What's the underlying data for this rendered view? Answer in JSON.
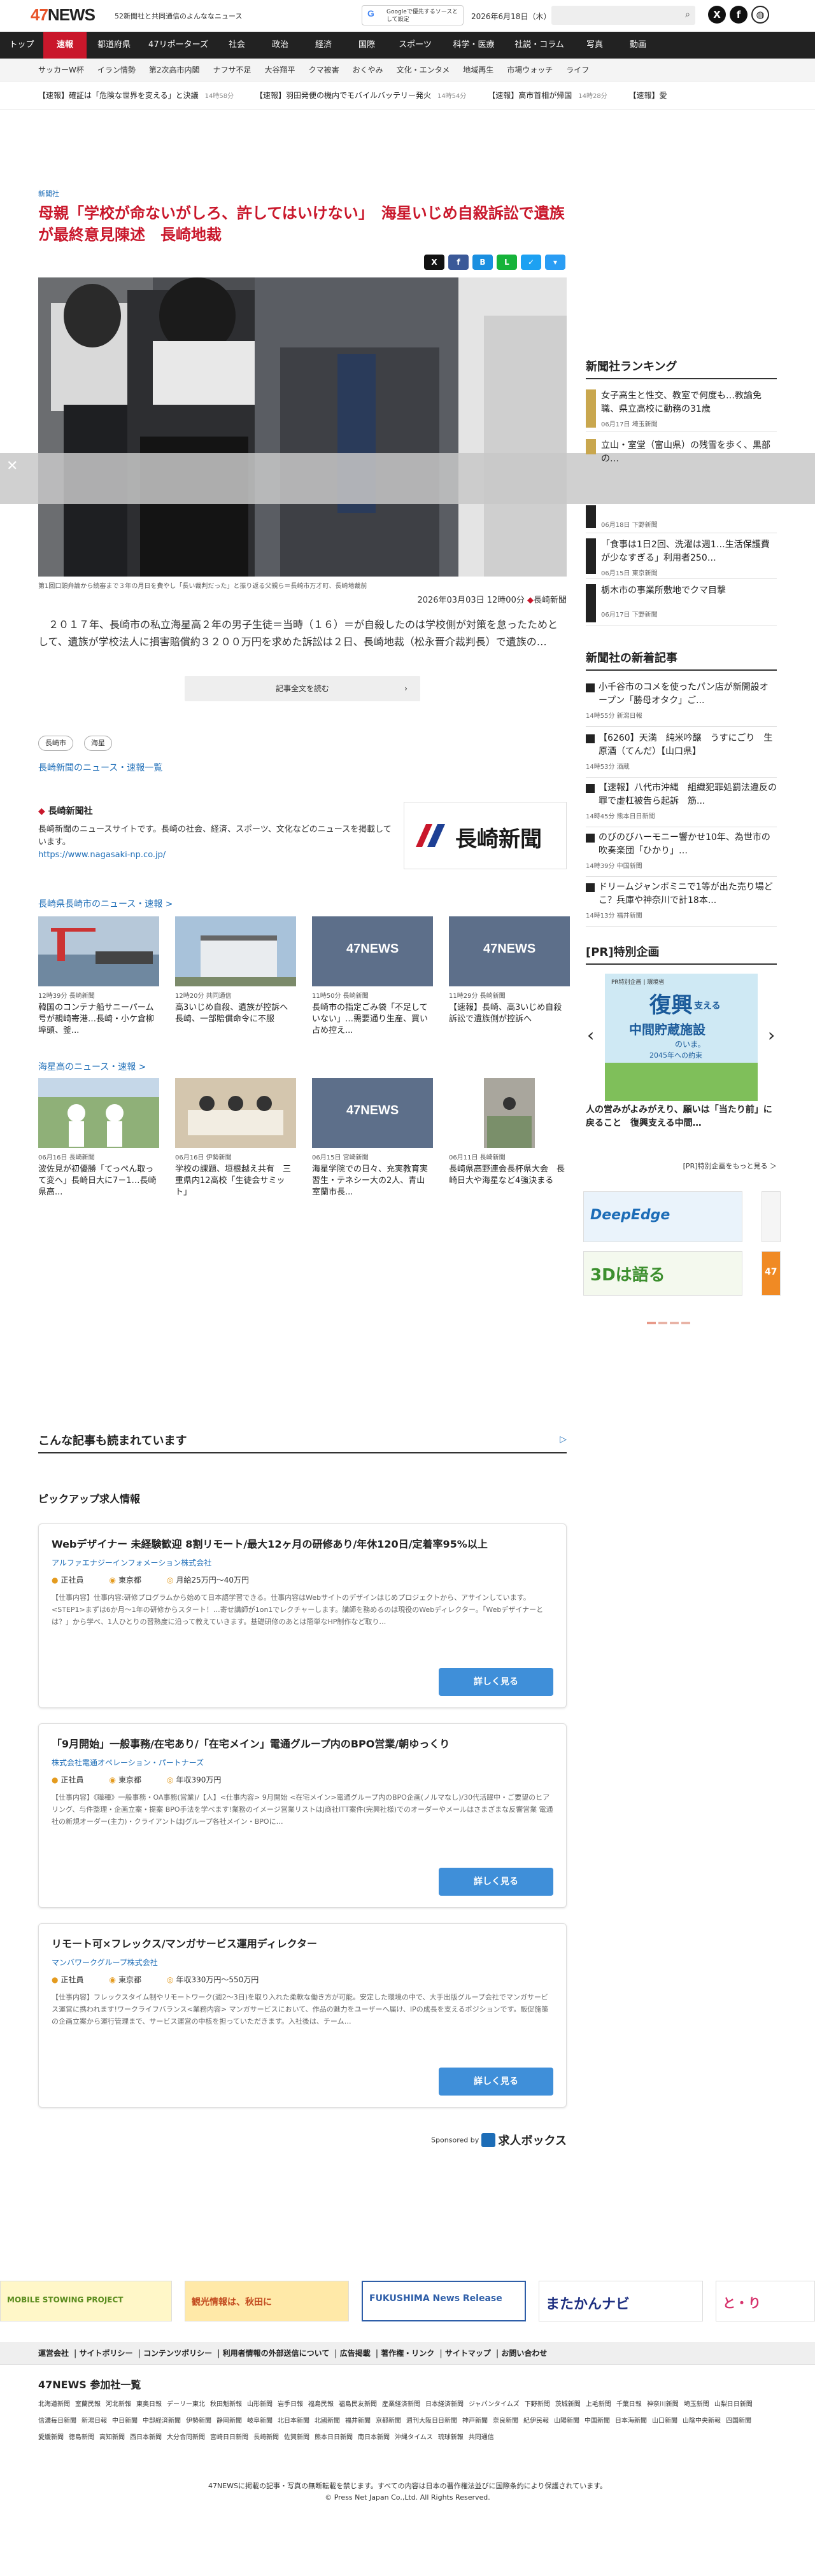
{
  "header": {
    "logo_num": "47",
    "logo_text": "NEWS",
    "tagline": "52新聞社と共同通信のよんななニュース",
    "google_btn": "Googleで優先するソースとして設定",
    "date": "2026年6月18日（木）"
  },
  "nav": [
    "トップ",
    "速報",
    "都道府県",
    "47リポーターズ",
    "社会",
    "政治",
    "経済",
    "国際",
    "スポーツ",
    "科学・医療",
    "社説・コラム",
    "写真",
    "動画"
  ],
  "subnav": [
    "サッカーW杯",
    "イラン情勢",
    "第2次高市内閣",
    "ナフサ不足",
    "大谷翔平",
    "クマ被害",
    "おくやみ",
    "文化・エンタメ",
    "地域再生",
    "市場ウォッチ",
    "ライフ"
  ],
  "ticker": [
    {
      "text": "【速報】確証は「危険な世界を変える」と決議",
      "time": "14時58分"
    },
    {
      "text": "【速報】羽田発便の機内でモバイルバッテリー発火",
      "time": "14時54分"
    },
    {
      "text": "【速報】高市首相が帰国",
      "time": "14時28分"
    },
    {
      "text": "【速報】愛"
    }
  ],
  "article": {
    "source": "新聞社",
    "headline": "母親「学校が命ないがしろ、許してはいけない」　海星いじめ自殺訴訟で遺族が最終意見陳述　長崎地裁",
    "caption": "第1回口頭弁論から続審まで３年の月日を費やし「長い裁判だった」と振り返る父親ら＝長崎市万才町、長崎地裁前",
    "datetime": "2026年03月03日 12時00分",
    "publisher": "長崎新聞",
    "lead": "　２０１７年、長崎市の私立海星高２年の男子生徒＝当時（１６）＝が自殺したのは学校側が対策を怠ったためとして、遺族が学校法人に損害賠償約３２００万円を求めた訴訟は２日、長崎地裁（松永晋介裁判長）で遺族の…",
    "readmore": "記事全文を読む",
    "tags": [
      "長崎市",
      "海星"
    ],
    "more_link": "長崎新聞のニュース・速報一覧"
  },
  "publisher_box": {
    "name": "長崎新聞社",
    "desc": "長崎新聞のニュースサイトです。長崎の社会、経済、スポーツ、文化などのニュースを掲載しています。",
    "url": "https://www.nagasaki-np.co.jp/",
    "logo_text": "長崎新聞"
  },
  "sec1": {
    "title": "長崎県長崎市のニュース・速報 >",
    "cards": [
      {
        "meta": "12時39分 長崎新聞",
        "title": "韓国のコンテナ船サニーパーム号が親崎寄港…長崎・小ケ倉柳埠頭、釜..."
      },
      {
        "meta": "12時20分 共同通信",
        "title": "高3いじめ自殺、遺族が控訴へ　長崎、一部賠償命令に不服"
      },
      {
        "meta": "11時50分 長崎新聞",
        "title": "長崎市の指定ごみ袋「不足していない」…需要通り生産、買い占め控え..."
      },
      {
        "meta": "11時29分 長崎新聞",
        "title": "【速報】長崎、高3いじめ自殺訴訟で遺族側が控訴へ"
      }
    ]
  },
  "sec2": {
    "title": "海星高のニュース・速報 >",
    "cards": [
      {
        "meta": "06月16日 長崎新聞",
        "title": "波佐見が初優勝「てっぺん取って変へ」長崎日大に7－1…長崎県高..."
      },
      {
        "meta": "06月16日 伊勢新聞",
        "title": "学校の課題、垣根越え共有　三重県内12高校「生徒会サミット」"
      },
      {
        "meta": "06月15日 宮崎新聞",
        "title": "海星学院での日々、充実教育実習生・テネシー大の2人、青山室蘭市長..."
      },
      {
        "meta": "06月11日 長崎新聞",
        "title": "長崎県高野連会長杯県大会　長崎日大や海星など4強決まる"
      }
    ]
  },
  "sidebar": {
    "ranking_title": "新聞社ランキング",
    "ranking": [
      {
        "title": "女子高生と性交、教室で何度も…教諭免職、県立高校に勤務の31歳",
        "meta": "06月17日 埼玉新聞"
      },
      {
        "title": "立山・室堂（富山県）の残雪を歩く、黒部の…",
        "meta": ""
      },
      {
        "title": "",
        "meta": "06月18日 下野新聞"
      },
      {
        "title": "「食事は1日2回、洗濯は週1…生活保護費が少なすぎる」利用者250…",
        "meta": "06月15日 東京新聞"
      },
      {
        "title": "栃木市の事業所敷地でクマ目撃",
        "meta": "06月17日 下野新聞"
      }
    ],
    "latest_title": "新聞社の新着記事",
    "latest": [
      {
        "title": "小千谷市のコメを使ったパン店が新開設オープン「勝母オタク」ご...",
        "meta": "14時55分 新潟日報"
      },
      {
        "title": "【6260】天満　純米吟醸　うすにごり　生原酒（てんだ）【山口県】",
        "meta": "14時53分 酒蔵"
      },
      {
        "title": "【速報】八代市沖縄　組織犯罪処罰法違反の罪で虚杠被告ら起訴　筋...",
        "meta": "14時45分 熊本日日新聞"
      },
      {
        "title": "のびのびハーモニー響かせ10年、為世市の吹奏楽団「ひかり」…",
        "meta": "14時39分 中国新聞"
      },
      {
        "title": "ドリームジャンボミニで1等が出た売り場どこ？兵庫や神奈川で計18本...",
        "meta": "14時13分 福井新聞"
      }
    ],
    "pr_title": "[PR]特別企画",
    "pr_banner_label": "PR特別企画 | 環境省",
    "pr_banner_big": "復興",
    "pr_banner_line2": "支える",
    "pr_banner_line3": "中間貯蔵施設",
    "pr_banner_line4": "のいま。",
    "pr_banner_line5": "2045年への約束",
    "pr_caption": "人の営みがよみがえり、願いは「当たり前」に戻ること　復興支える中間…",
    "pr_more": "[PR]特別企画をもっと見る ＞",
    "ad_labels": [
      "DeepEdge",
      "3Dは語る",
      "47"
    ]
  },
  "also": {
    "title": "こんな記事も読まれています",
    "badge": "▷"
  },
  "pickup": {
    "title": "ピックアップ求人情報",
    "jobs": [
      {
        "title": "Webデザイナー 未経験歓迎 8割リモート/最大12ヶ月の研修あり/年休120日/定着率95%以上",
        "company": "アルファエナジーインフォメーション株式会社",
        "type": "正社員",
        "place": "東京都",
        "pay": "月給25万円〜40万円",
        "desc": "【仕事内容】仕事内容:研修プログラムから始めて日本語学習できる。仕事内容はWebサイトのデザインはじめプロジェクトから、アサインしています。<STEP1>まずは6か月～1年の研修からスタート！…寄せ講師が1on1でレクチャーします。講師を務めるのは現役のWebディレクター。「Webデザイナーとは？」から学べ、1人ひとりの習熟度に沿って教えていきます。基礎研修のあとは簡単なHP制作など取り…",
        "btn": "詳しく見る"
      },
      {
        "title": "「9月開始」一般事務/在宅あり/「在宅メイン」電通グループ内のBPO営業/朝ゆっくり",
        "company": "株式会社電通オペレーション・パートナーズ",
        "type": "正社員",
        "place": "東京都",
        "pay": "年収390万円",
        "desc": "【仕事内容】《職種》一般事務・OA事務(営業)/【人】<仕事内容> 9月開始 <在宅メイン>電通グループ内のBPO企画(ノルマなし)/30代活躍中・ご要望のヒアリング、与件整理・企画立案・提案 BPO手法を学べます!業務のイメージ営業リストはJ商社ITT案件(完興社様)でのオーダーやメールはさまざまな反響営業 電通社の新規オーダー(主力)・クライアントはJグループ各社メイン・BPOに…",
        "btn": "詳しく見る"
      },
      {
        "title": "リモート可×フレックス/マンガサービス運用ディレクター",
        "company": "マンバワークグループ株式会社",
        "type": "正社員",
        "place": "東京都",
        "pay": "年収330万円〜550万円",
        "desc": "【仕事内容】フレックスタイム制やリモートワーク(週2～3日)を取り入れた柔軟な働き方が可能。安定した環境の中で、大手出版グループ会社でマンガサービス運営に携われます!ワークライフバランス<業務内容> マンガサービスにおいて、作品の魅力をユーザーへ届け、IPの成長を支えるポジションです。販促施策の企画立案から運行管理まで、サービス運営の中核を担っていただきます。入社後は、チーム…",
        "btn": "詳しく見る"
      }
    ],
    "sponsored": "Sponsored by",
    "sponsor": "求人ボックス"
  },
  "banners": [
    "MOBILE STOWING PROJECT",
    "観光情報は、秋田に",
    "FUKUSHIMA News Release",
    "またかんナビ",
    "と・り"
  ],
  "footer": {
    "links": [
      "運営会社",
      "サイトポリシー",
      "コンテンツポリシー",
      "利用者情報の外部送信について",
      "広告掲載",
      "著作権・リンク",
      "サイトマップ",
      "お問い合わせ"
    ],
    "papers_title": "47NEWS 参加社一覧",
    "papers": [
      "北海道新聞",
      "室蘭民報",
      "河北新報",
      "東奥日報",
      "デーリー東北",
      "秋田魁新報",
      "山形新聞",
      "岩手日報",
      "福島民報",
      "福島民友新聞",
      "産業経済新聞",
      "日本経済新聞",
      "ジャパンタイムズ",
      "下野新聞",
      "茨城新聞",
      "上毛新聞",
      "千葉日報",
      "神奈川新聞",
      "埼玉新聞",
      "山梨日日新聞",
      "信濃毎日新聞",
      "新潟日報",
      "中日新聞",
      "中部経済新聞",
      "伊勢新聞",
      "静岡新聞",
      "岐阜新聞",
      "北日本新聞",
      "北國新聞",
      "福井新聞",
      "京都新聞",
      "週刊大阪日日新聞",
      "神戸新聞",
      "奈良新聞",
      "紀伊民報",
      "山陽新聞",
      "中国新聞",
      "日本海新聞",
      "山口新聞",
      "山陰中央新報",
      "四国新聞",
      "愛媛新聞",
      "徳島新聞",
      "高知新聞",
      "西日本新聞",
      "大分合同新聞",
      "宮崎日日新聞",
      "長崎新聞",
      "佐賀新聞",
      "熊本日日新聞",
      "南日本新聞",
      "沖縄タイムス",
      "琉球新報",
      "共同通信"
    ],
    "copy1": "47NEWSに掲載の記事・写真の無断転載を禁じます。すべての内容は日本の著作権法並びに国際条約により保護されています。",
    "copy2": "© Press Net Japan Co.,Ltd. All Rights Reserved."
  },
  "colors": {
    "accent": "#c9172b",
    "link": "#1d6db7",
    "nav_bg": "#222222",
    "button": "#3f8fd9"
  }
}
